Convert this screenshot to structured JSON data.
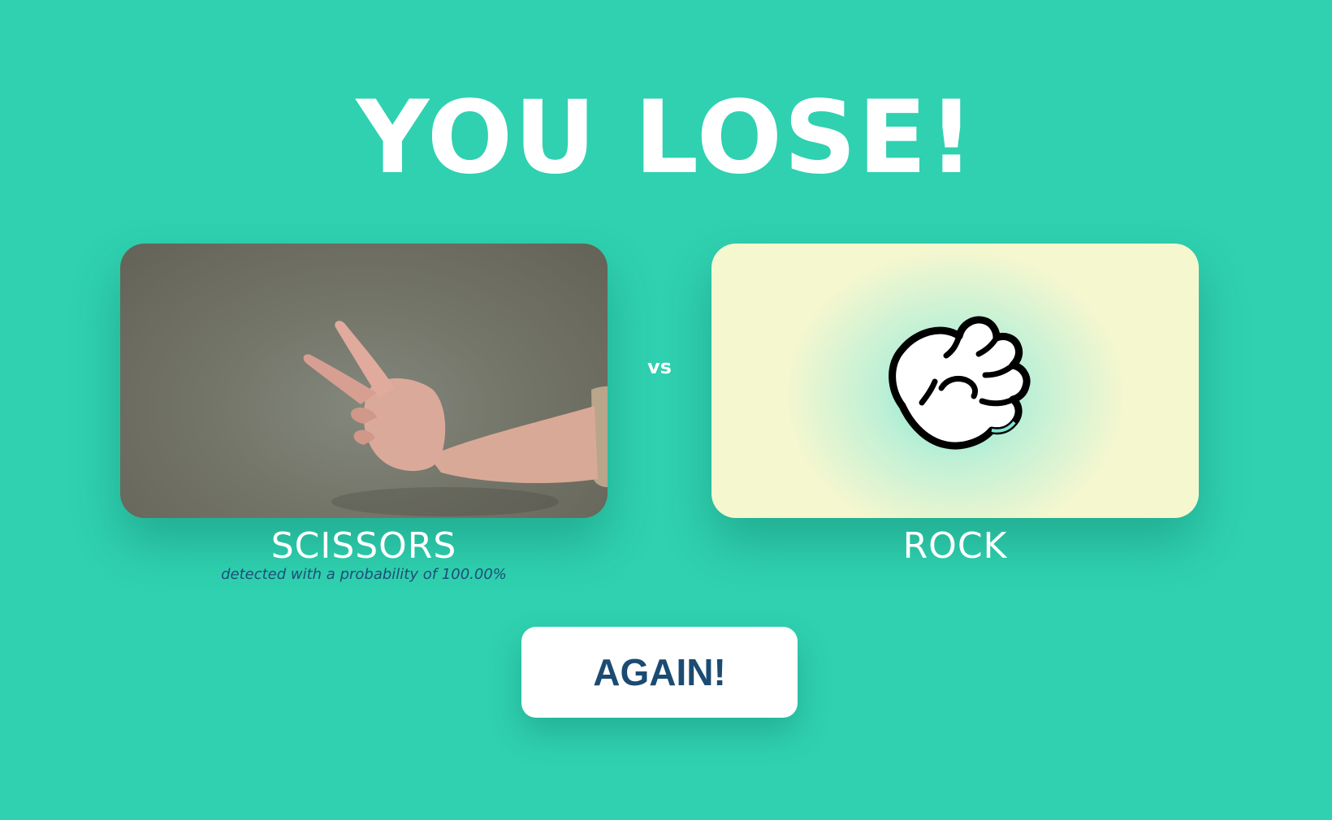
{
  "result": {
    "title": "YOU LOSE!"
  },
  "player": {
    "move": "SCISSORS",
    "detection_text": "detected with a probability of 100.00%"
  },
  "versus": "vs",
  "computer": {
    "move": "ROCK",
    "icon": "fist-icon"
  },
  "actions": {
    "again_label": "AGAIN!"
  },
  "colors": {
    "background": "#2fd1b0",
    "computer_card": "#f5f7cf",
    "button_text": "#1b4b72",
    "detection_text": "#1f4e78"
  }
}
